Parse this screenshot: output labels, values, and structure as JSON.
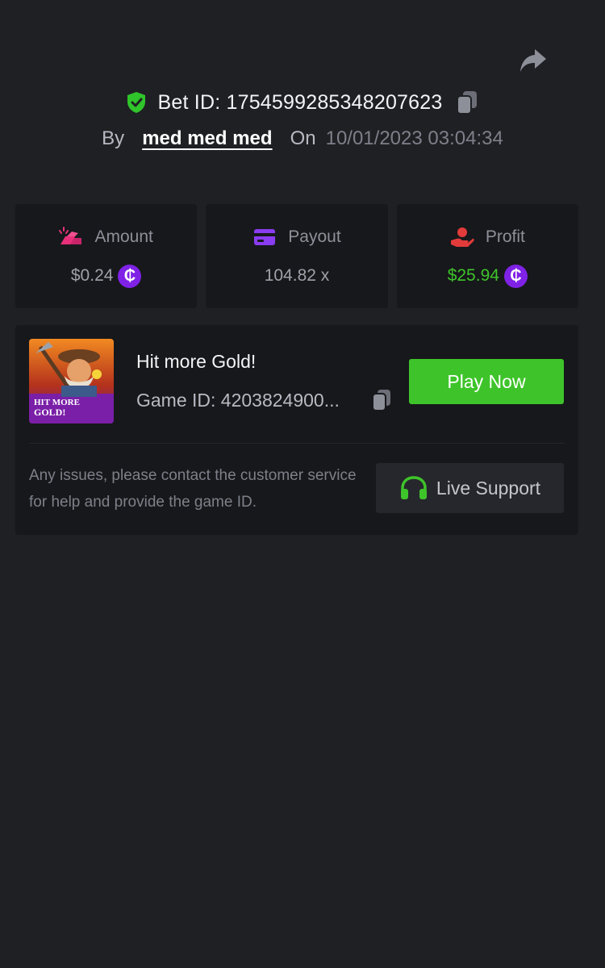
{
  "header": {
    "bet_id": "Bet ID: 1754599285348207623",
    "by_label": "By",
    "user": "med med med",
    "on_label": "On",
    "date": "10/01/2023 03:04:34"
  },
  "stats": [
    {
      "label": "Amount",
      "value": "$0.24",
      "icon": "gold-bars-icon",
      "currency_symbol": "₵"
    },
    {
      "label": "Payout",
      "value": "104.82 x",
      "icon": "card-icon"
    },
    {
      "label": "Profit",
      "value": "$25.94",
      "icon": "hand-coin-icon",
      "currency_symbol": "₵"
    }
  ],
  "game": {
    "title": "Hit more Gold!",
    "game_id": "Game ID: 4203824900...",
    "thumbnail_text": "HIT MORE GOLD!",
    "play_label": "Play Now"
  },
  "support": {
    "text": "Any issues, please contact the customer service for help and provide the game ID.",
    "button_label": "Live Support"
  },
  "colors": {
    "background": "#1f2024",
    "card": "#17181b",
    "accent_green": "#3ec42a",
    "coin_purple": "#7f22e6",
    "amount_icon": "#e8307a",
    "payout_icon": "#8a3cf0",
    "profit_icon": "#e23b3b"
  }
}
